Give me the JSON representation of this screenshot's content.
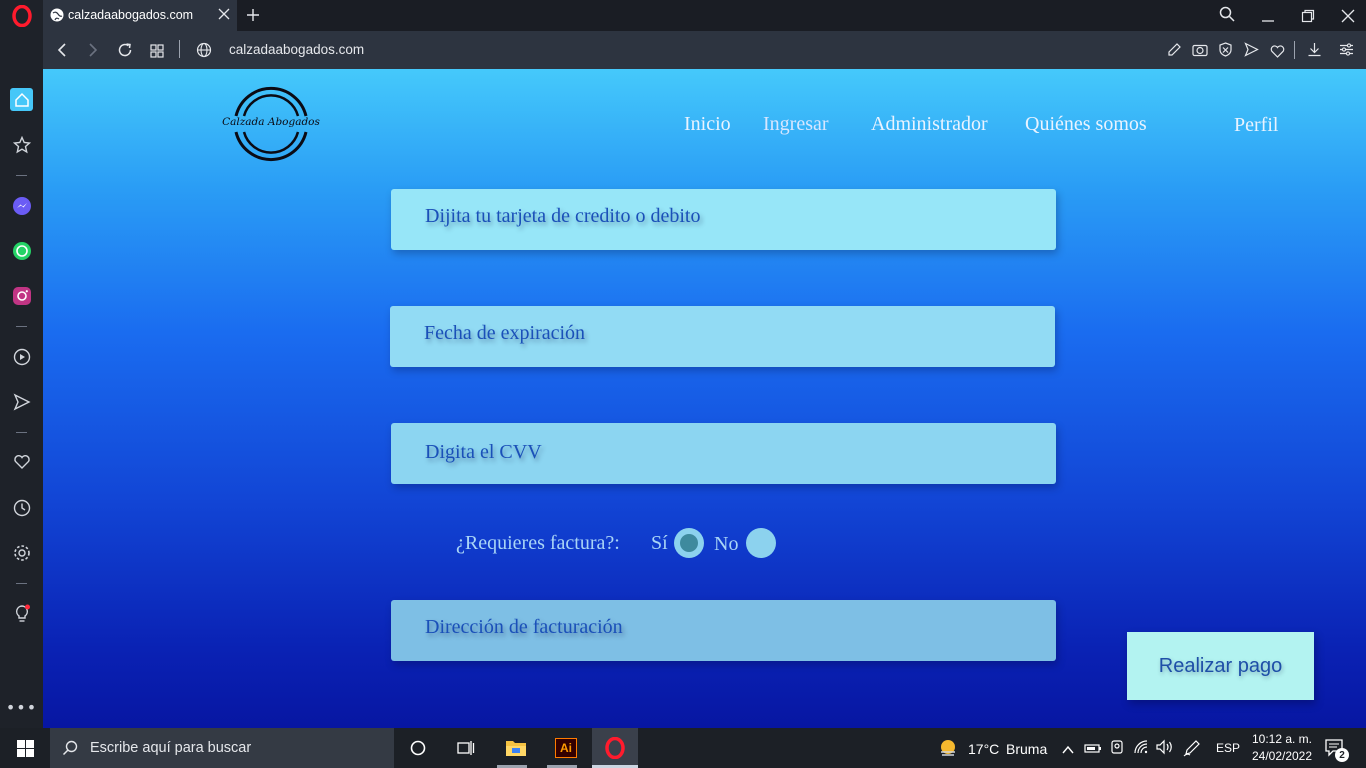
{
  "browser": {
    "tab": {
      "title": "calzadaabogados.com"
    },
    "address": {
      "url": "calzadaabogados.com"
    }
  },
  "site": {
    "logo_text": "Calzada Abogados",
    "nav": [
      "Inicio",
      "Ingresar",
      "Administrador",
      "Quiénes somos"
    ],
    "profile": "Perfil"
  },
  "form": {
    "card_placeholder": "Dijita tu tarjeta de credito o debito",
    "expiry_placeholder": "Fecha de expiración",
    "cvv_placeholder": "Digita el CVV",
    "invoice_question": "¿Requieres factura?:",
    "yes": "Sí",
    "no": "No",
    "invoice_selected": "Sí",
    "address_placeholder": "Dirección de facturación",
    "submit": "Realizar pago"
  },
  "taskbar": {
    "search_placeholder": "Escribe aquí para buscar",
    "weather_temp": "17°C",
    "weather_desc": "Bruma",
    "language": "ESP",
    "time": "10:12 a. m.",
    "date": "24/02/2022",
    "notifications_count": "2"
  },
  "colors": {
    "accent_button": "#b3f3f1",
    "field_bg": "#8fd8f2",
    "field_text": "#1a50b9"
  }
}
